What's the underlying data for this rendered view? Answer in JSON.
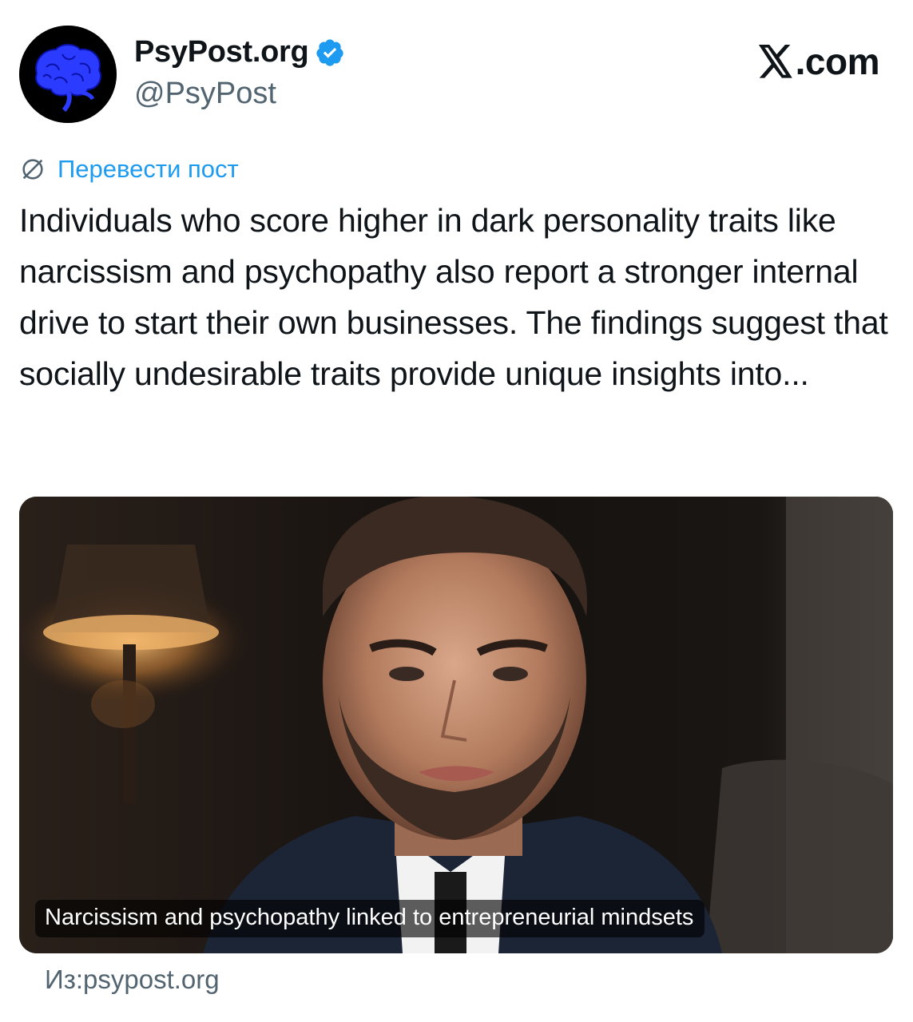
{
  "header": {
    "display_name": "PsyPost.org",
    "handle": "@PsyPost",
    "brand": ".com"
  },
  "translate_label": "Перевести пост",
  "post": {
    "text": "Individuals who score higher in dark personality traits like narcissism and psychopathy also report a stronger internal drive to start their own businesses. The findings suggest that socially undesirable traits provide unique insights into..."
  },
  "card": {
    "caption": "Narcissism and psychopathy linked to entrepreneurial mindsets",
    "source": "Из:psypost.org"
  },
  "icons": {
    "avatar": "brain-icon",
    "verified": "verified-badge-icon",
    "translate": "globe-icon",
    "brand": "x-logo-icon"
  },
  "colors": {
    "link": "#1d9bf0",
    "secondary_text": "#536471",
    "verified": "#1d9bf0"
  }
}
